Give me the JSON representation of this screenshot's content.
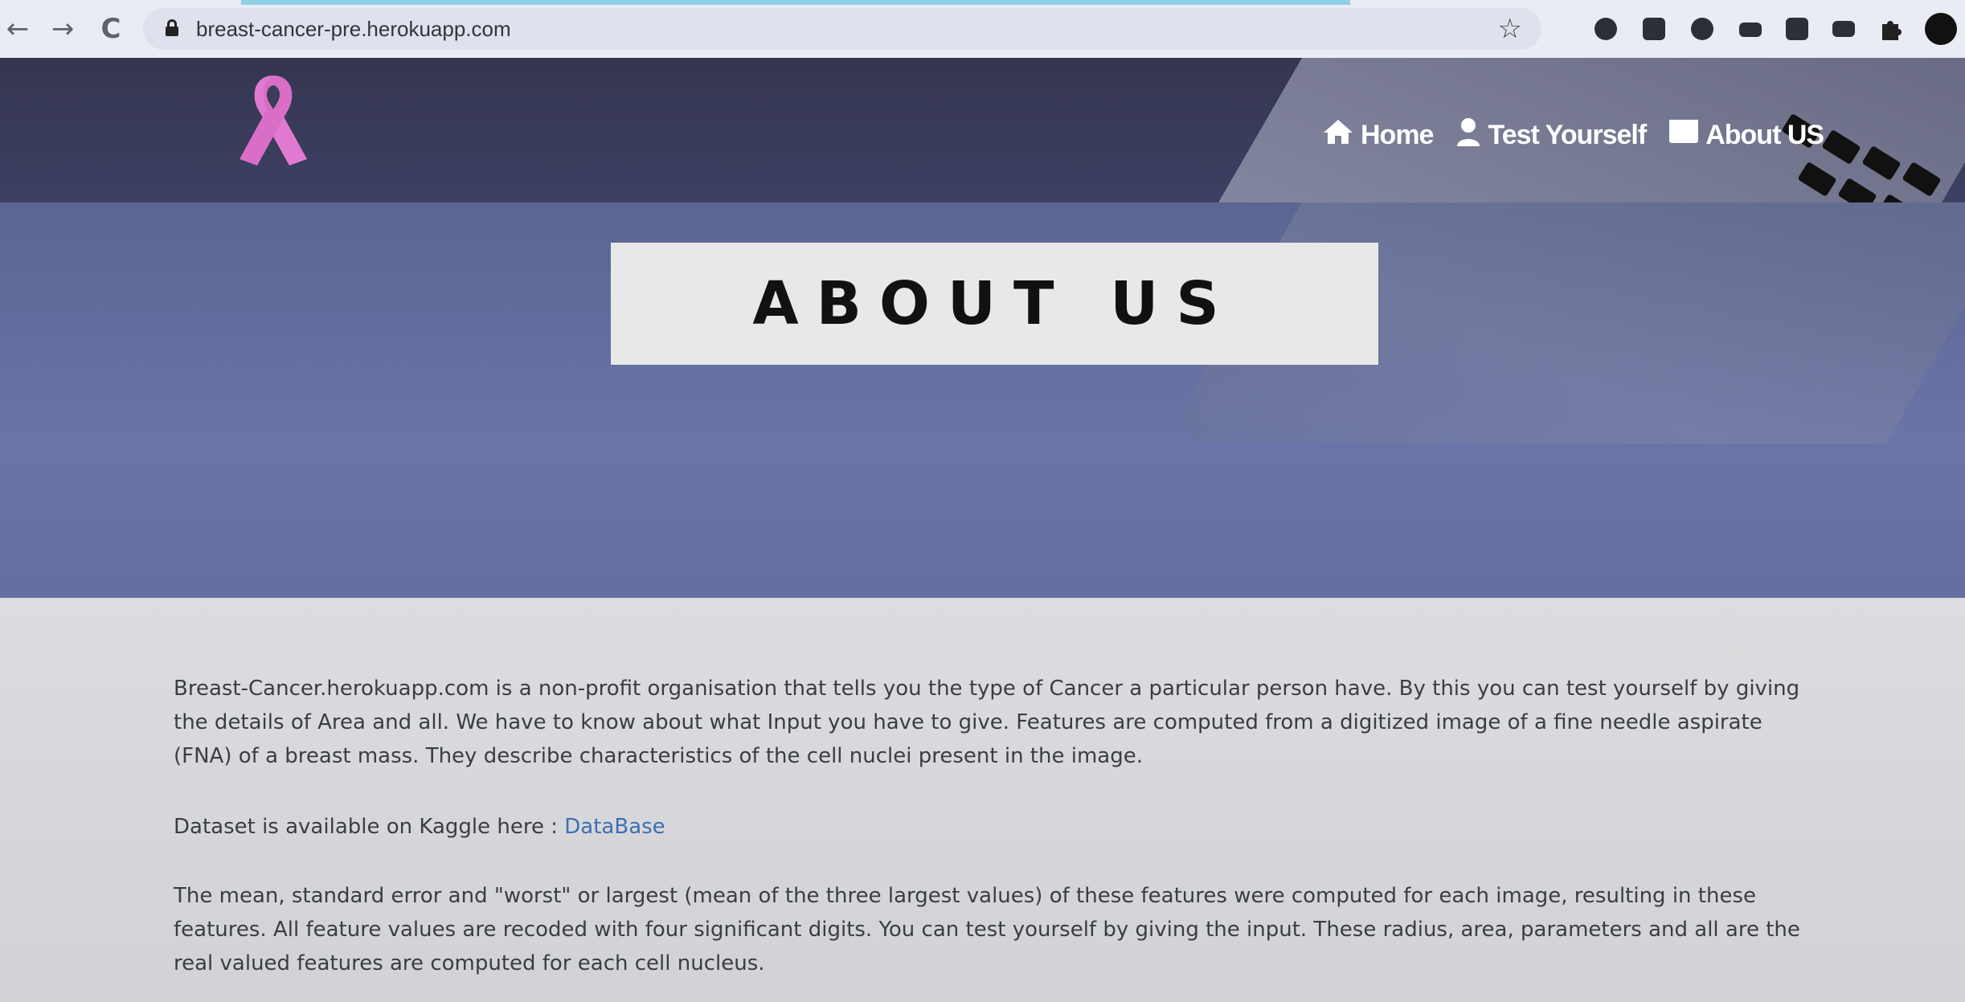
{
  "browser": {
    "url": "breast-cancer-pre.herokuapp.com",
    "back_icon": "←",
    "forward_icon": "→",
    "reload_icon": "C",
    "bookmark_icon": "☆"
  },
  "header": {
    "nav": [
      {
        "label": "Home",
        "icon": "home-icon"
      },
      {
        "label": "Test Yourself",
        "icon": "user-icon"
      },
      {
        "label": "About US",
        "icon": "id-card-icon"
      }
    ]
  },
  "hero": {
    "title": "ABOUT US"
  },
  "content": {
    "paragraph1": "Breast-Cancer.herokuapp.com is a non-profit organisation that tells you the type of Cancer a particular person have. By this you can test yourself by giving the details of Area and all. We have to know about what Input you have to give. Features are computed from a digitized image of a fine needle aspirate (FNA) of a breast mass. They describe characteristics of the cell nuclei present in the image.",
    "dataset_text": "Dataset is available on Kaggle here : ",
    "dataset_link": "DataBase",
    "paragraph3": "The mean, standard error and \"worst\" or largest (mean of the three largest values) of these features were computed for each image, resulting in these features. All feature values are recoded with four significant digits. You can test yourself by giving the input. These radius, area, parameters and all are the real valued features are computed for each cell nucleus."
  },
  "colors": {
    "header_bg": "#343650",
    "hero_bg": "#6470a1",
    "ribbon": "#e07ad0",
    "link": "#3f6fb2"
  }
}
